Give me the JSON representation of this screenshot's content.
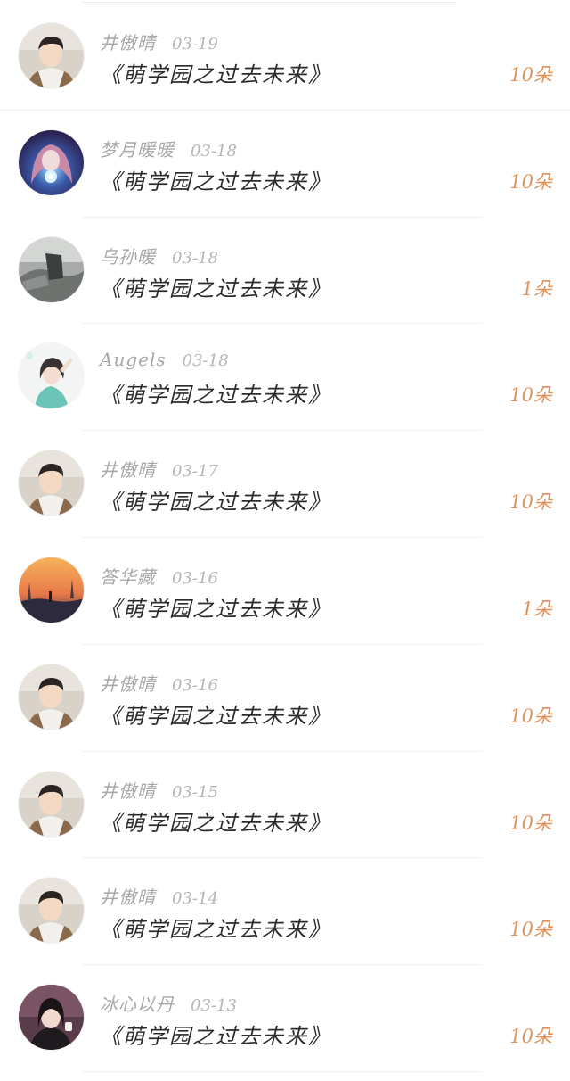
{
  "gift_list": [
    {
      "user": "井傲晴",
      "date": "03-19",
      "title": "《萌学园之过去未来》",
      "amount": "10朵",
      "avatar": "boy-portrait-avatar"
    },
    {
      "user": "梦月暖暖",
      "date": "03-18",
      "title": "《萌学园之过去未来》",
      "amount": "10朵",
      "avatar": "anime-girl-avatar"
    },
    {
      "user": "乌孙暖",
      "date": "03-18",
      "title": "《萌学园之过去未来》",
      "amount": "1朵",
      "avatar": "grey-scenery-avatar"
    },
    {
      "user": "Augels",
      "date": "03-18",
      "title": "《萌学园之过去未来》",
      "amount": "10朵",
      "avatar": "girl-illustration-avatar"
    },
    {
      "user": "井傲晴",
      "date": "03-17",
      "title": "《萌学园之过去未来》",
      "amount": "10朵",
      "avatar": "boy-portrait-avatar"
    },
    {
      "user": "答华藏",
      "date": "03-16",
      "title": "《萌学园之过去未来》",
      "amount": "1朵",
      "avatar": "sunset-scene-avatar"
    },
    {
      "user": "井傲晴",
      "date": "03-16",
      "title": "《萌学园之过去未来》",
      "amount": "10朵",
      "avatar": "boy-portrait-avatar"
    },
    {
      "user": "井傲晴",
      "date": "03-15",
      "title": "《萌学园之过去未来》",
      "amount": "10朵",
      "avatar": "boy-portrait-avatar"
    },
    {
      "user": "井傲晴",
      "date": "03-14",
      "title": "《萌学园之过去未来》",
      "amount": "10朵",
      "avatar": "boy-portrait-avatar"
    },
    {
      "user": "冰心以丹",
      "date": "03-13",
      "title": "《萌学园之过去未来》",
      "amount": "10朵",
      "avatar": "girl-photo-avatar"
    }
  ],
  "colors": {
    "amount": "#e0935d",
    "meta": "#a8a8a8",
    "title": "#2b2b2b",
    "divider": "#f0f0f0"
  }
}
